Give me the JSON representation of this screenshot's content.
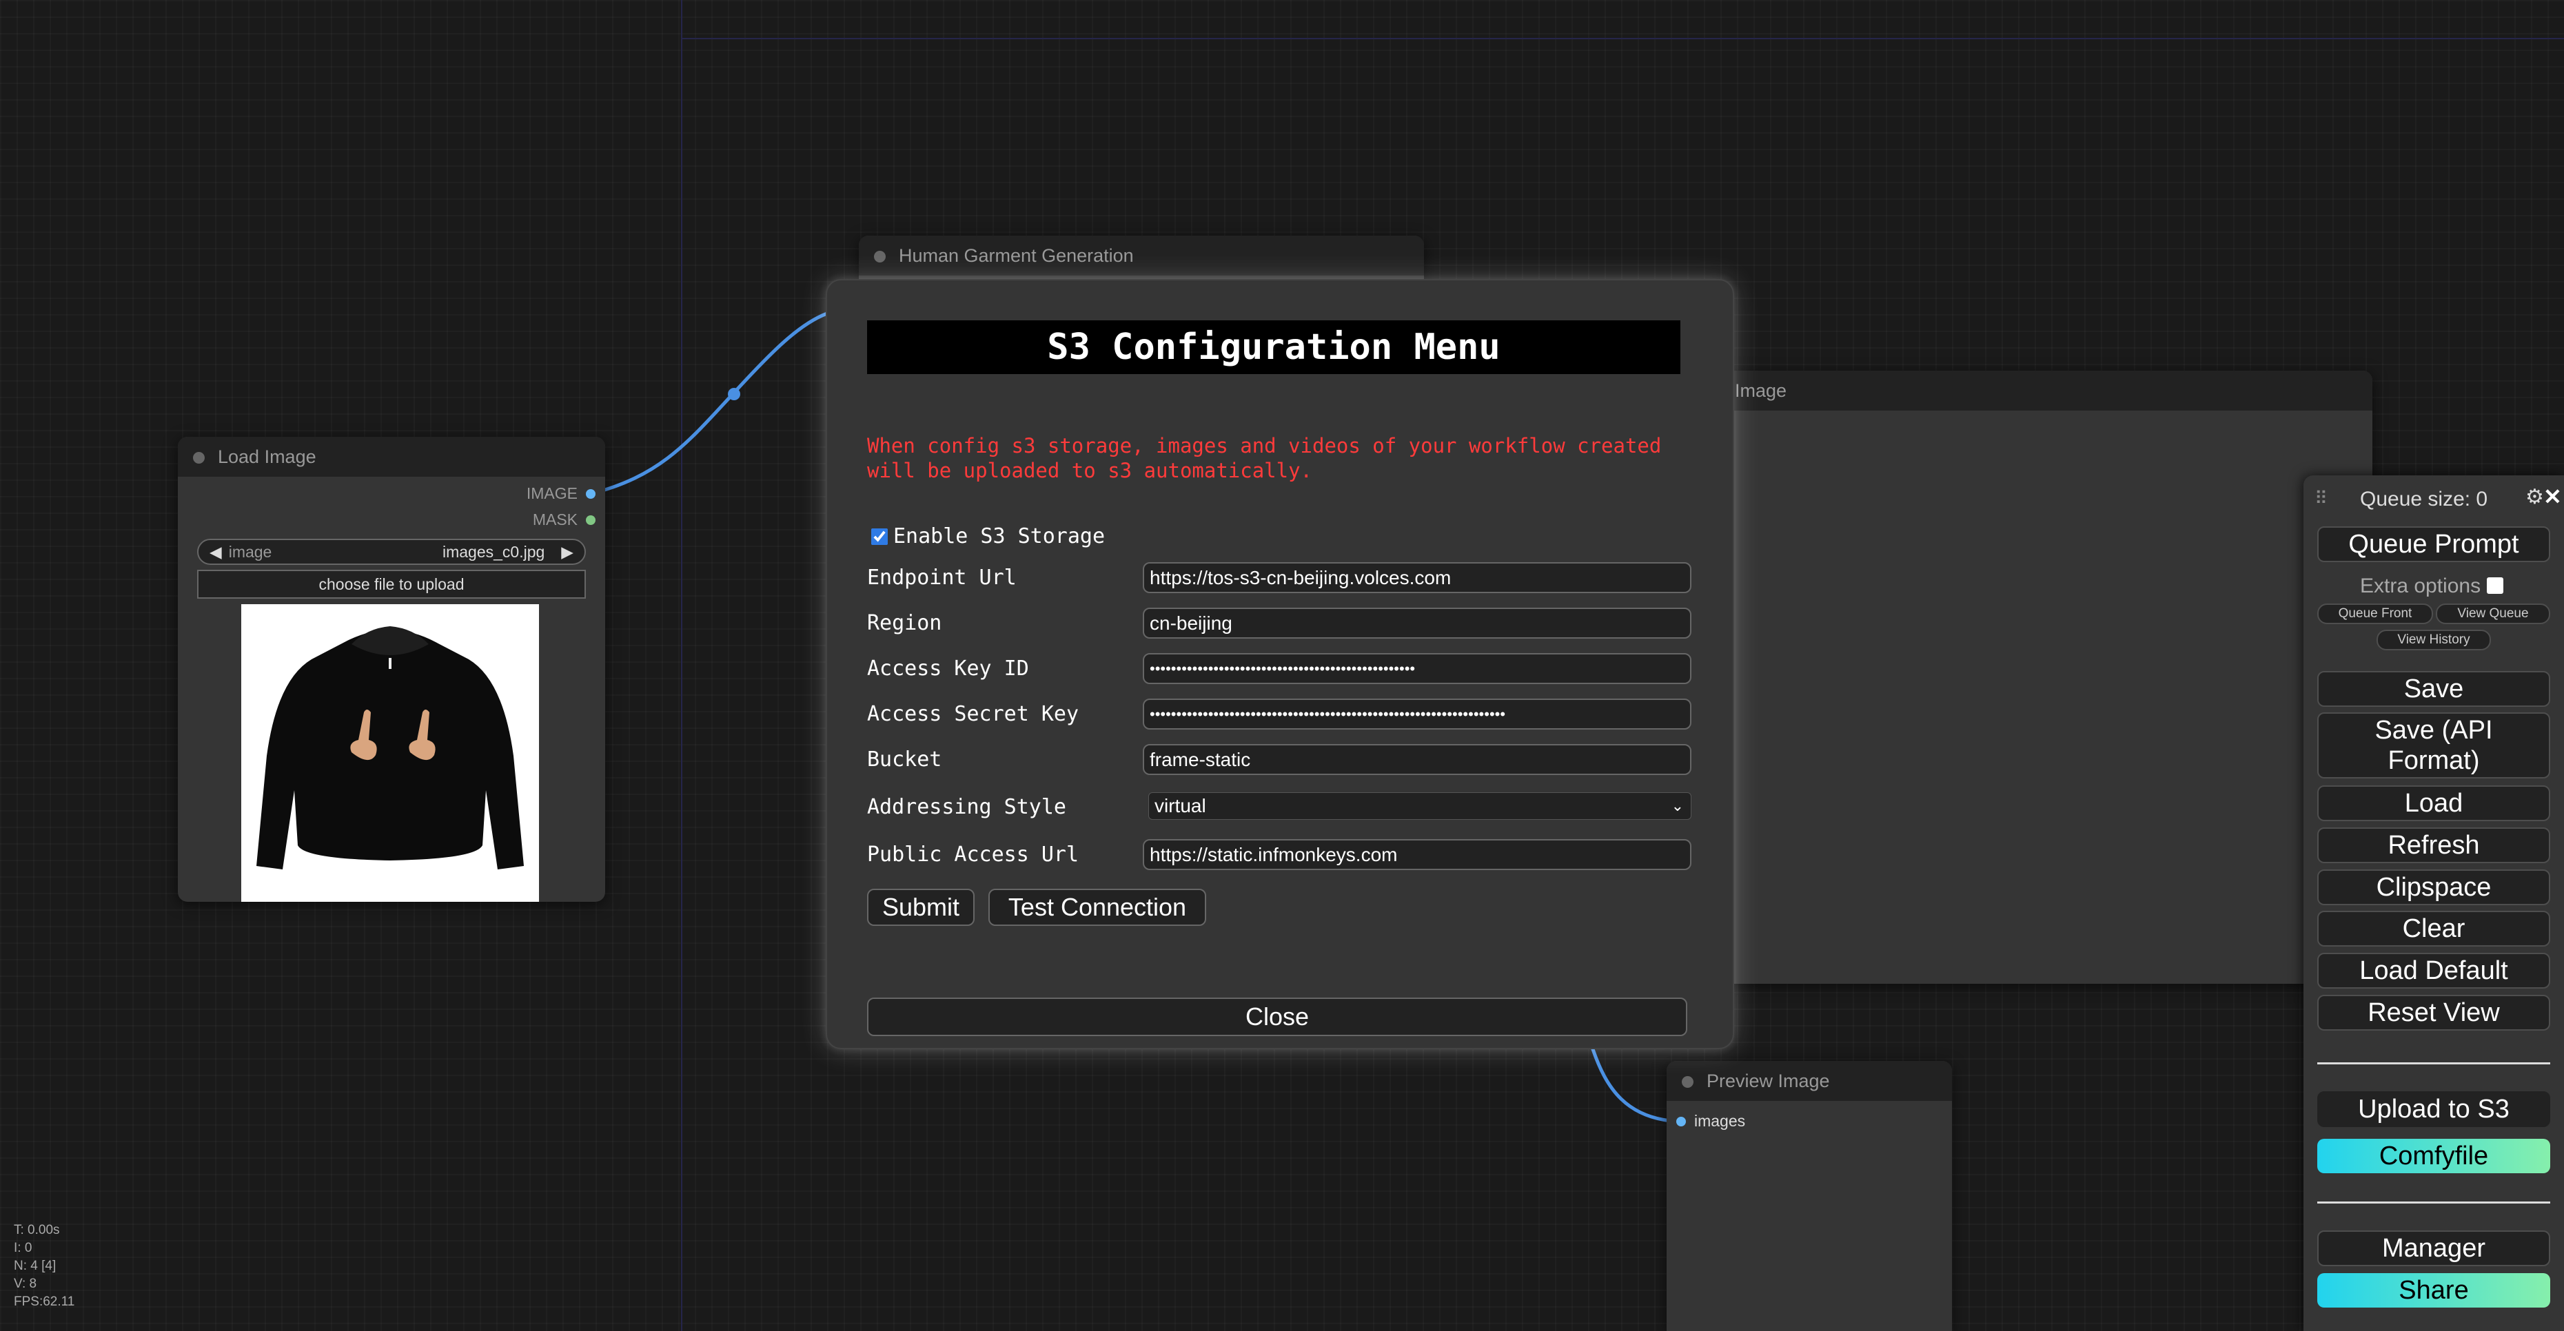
{
  "stats": {
    "t": "T: 0.00s",
    "i": "I: 0",
    "n": "N: 4 [4]",
    "v": "V: 8",
    "fps": "FPS:62.11"
  },
  "load_image_node": {
    "title": "Load Image",
    "out_image": "IMAGE",
    "out_mask": "MASK",
    "widget_name": "image",
    "widget_value": "images_c0.jpg",
    "upload_label": "choose file to upload"
  },
  "garment_node": {
    "title": "Human Garment Generation"
  },
  "save_image_node": {
    "title_fragment": "w Image"
  },
  "preview_node": {
    "title": "Preview Image",
    "input": "images"
  },
  "modal": {
    "title": "S3 Configuration Menu",
    "warning": "When config s3 storage, images and videos of your workflow created will be uploaded to s3 automatically.",
    "enable_label": "Enable S3 Storage",
    "enable_checked": true,
    "fields": [
      {
        "label": "Endpoint Url",
        "value": "https://tos-s3-cn-beijing.volces.com"
      },
      {
        "label": "Region",
        "value": "cn-beijing"
      },
      {
        "label": "Access Key ID",
        "value": "••••••••••••••••••••••••••••••••••••••••••••••••••"
      },
      {
        "label": "Access Secret Key",
        "value": "•••••••••••••••••••••••••••••••••••••••••••••••••••••••••••••••••••"
      },
      {
        "label": "Bucket",
        "value": "frame-static"
      },
      {
        "label": "Addressing Style",
        "value": "virtual"
      },
      {
        "label": "Public Access Url",
        "value": "https://static.infmonkeys.com"
      }
    ],
    "submit": "Submit",
    "test": "Test Connection",
    "close": "Close"
  },
  "side_menu": {
    "queue_size": "Queue size: 0",
    "queue_prompt": "Queue Prompt",
    "extra_options": "Extra options",
    "queue_front": "Queue Front",
    "view_queue": "View Queue",
    "view_history": "View History",
    "save": "Save",
    "save_api": "Save (API Format)",
    "load": "Load",
    "refresh": "Refresh",
    "clipspace": "Clipspace",
    "clear": "Clear",
    "load_default": "Load Default",
    "reset_view": "Reset View",
    "upload_s3": "Upload to S3",
    "comfyfile": "Comfyfile",
    "manager": "Manager",
    "share": "Share"
  },
  "colors": {
    "link": "#4a90e2",
    "warning": "#ff3b3b",
    "accent_gradient_start": "#22d3ee",
    "accent_gradient_end": "#86efac"
  }
}
